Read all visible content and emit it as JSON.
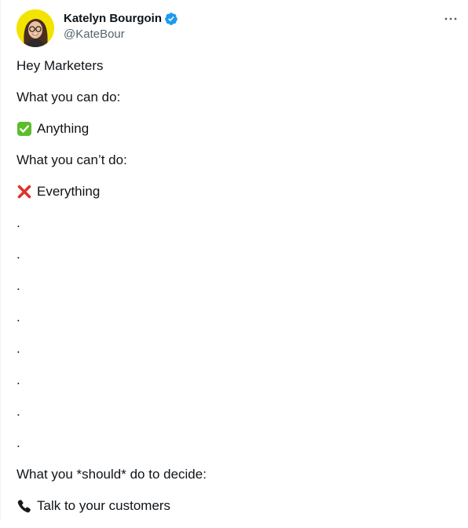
{
  "author": {
    "display_name": "Katelyn Bourgoin",
    "handle": "@KateBour"
  },
  "menu": {
    "more_label": "···"
  },
  "tweet": {
    "lines": [
      {
        "emoji": "",
        "text": "Hey Marketers"
      },
      {
        "emoji": "",
        "text": "What you can do:"
      },
      {
        "emoji": "check-mark-icon",
        "text": "Anything"
      },
      {
        "emoji": "",
        "text": "What you can’t do:"
      },
      {
        "emoji": "cross-mark-icon",
        "text": "Everything"
      },
      {
        "emoji": "",
        "text": "."
      },
      {
        "emoji": "",
        "text": "."
      },
      {
        "emoji": "",
        "text": "."
      },
      {
        "emoji": "",
        "text": "."
      },
      {
        "emoji": "",
        "text": "."
      },
      {
        "emoji": "",
        "text": "."
      },
      {
        "emoji": "",
        "text": "."
      },
      {
        "emoji": "",
        "text": "."
      },
      {
        "emoji": "",
        "text": "What you *should* do to decide:"
      },
      {
        "emoji": "telephone-icon",
        "text": "Talk to your customers"
      }
    ]
  },
  "colors": {
    "name": "#0f1419",
    "handle": "#536471",
    "verified": "#1d9bf0",
    "avatar_bg": "#f2e400",
    "check_green": "#5bbd2b",
    "cross_red": "#e0322c"
  }
}
